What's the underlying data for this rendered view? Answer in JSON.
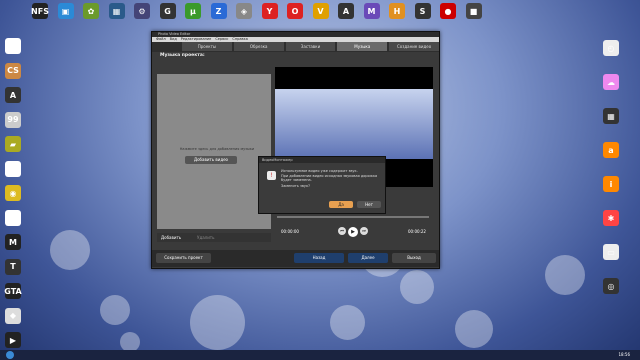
{
  "desktop": {
    "top_icons": [
      {
        "name": "need-for-speed-icon",
        "glyph": "NFS",
        "color": "#222"
      },
      {
        "name": "monitor-icon",
        "glyph": "▣",
        "color": "#2b8ad6"
      },
      {
        "name": "butterfly-icon",
        "glyph": "✿",
        "color": "#6b9a2b"
      },
      {
        "name": "video-app-icon",
        "glyph": "▦",
        "color": "#2a5a8a"
      },
      {
        "name": "gear-icon",
        "glyph": "⚙",
        "color": "#447"
      },
      {
        "name": "g-icon",
        "glyph": "G",
        "color": "#333"
      },
      {
        "name": "torrent-icon",
        "glyph": "µ",
        "color": "#3a9a2a"
      },
      {
        "name": "z-icon",
        "glyph": "Z",
        "color": "#2a6ad6"
      },
      {
        "name": "photo-app-icon",
        "glyph": "◈",
        "color": "#888"
      },
      {
        "name": "yandex-icon",
        "glyph": "Y",
        "color": "#d22"
      },
      {
        "name": "opera-icon",
        "glyph": "O",
        "color": "#d22"
      },
      {
        "name": "v-icon",
        "glyph": "V",
        "color": "#e0a000"
      },
      {
        "name": "a-icon",
        "glyph": "A",
        "color": "#333"
      },
      {
        "name": "m-icon",
        "glyph": "M",
        "color": "#6a4ab8"
      },
      {
        "name": "h-icon",
        "glyph": "H",
        "color": "#e09020"
      },
      {
        "name": "s-icon",
        "glyph": "S",
        "color": "#333"
      },
      {
        "name": "record-icon",
        "glyph": "●",
        "color": "#c00"
      },
      {
        "name": "box-icon",
        "glyph": "■",
        "color": "#444"
      }
    ],
    "left_icons": [
      {
        "name": "floppy-icon",
        "glyph": "▤",
        "color": "#fff"
      },
      {
        "name": "counter-strike-icon",
        "glyph": "CS",
        "color": "#c84"
      },
      {
        "name": "arma-icon",
        "glyph": "A",
        "color": "#333"
      },
      {
        "name": "fifa-icon",
        "glyph": "99",
        "color": "#ccc"
      },
      {
        "name": "car-icon",
        "glyph": "▰",
        "color": "#aa2"
      },
      {
        "name": "text-file-icon",
        "glyph": "▢",
        "color": "#fff"
      },
      {
        "name": "game-icon",
        "glyph": "◉",
        "color": "#db2"
      },
      {
        "name": "document-icon",
        "glyph": "▯",
        "color": "#fff"
      },
      {
        "name": "mafia-icon",
        "glyph": "M",
        "color": "#222"
      },
      {
        "name": "tanks-icon",
        "glyph": "T",
        "color": "#333"
      },
      {
        "name": "gta-icon",
        "glyph": "GTA",
        "color": "#222"
      },
      {
        "name": "cube-icon",
        "glyph": "◆",
        "color": "#ddd"
      },
      {
        "name": "play-icon",
        "glyph": "▶",
        "color": "#222"
      }
    ],
    "right_icons": [
      {
        "name": "clock-icon",
        "glyph": "◴",
        "color": "#eee"
      },
      {
        "name": "weather-icon",
        "glyph": "☁",
        "color": "#e8e"
      },
      {
        "name": "calculator-icon",
        "glyph": "▦",
        "color": "#333"
      },
      {
        "name": "avast-icon",
        "glyph": "a",
        "color": "#f80"
      },
      {
        "name": "info-icon",
        "glyph": "i",
        "color": "#f80"
      },
      {
        "name": "pinwheel-icon",
        "glyph": "✱",
        "color": "#f44"
      },
      {
        "name": "window-icon",
        "glyph": "▭",
        "color": "#eee"
      },
      {
        "name": "disk-icon",
        "glyph": "◎",
        "color": "#333"
      }
    ]
  },
  "window": {
    "title": "Photo Video Editor",
    "menu": [
      "Файл",
      "Вид",
      "Редактирование",
      "Сервис",
      "Справка"
    ],
    "tabs": [
      "Проекты",
      "Обрезка",
      "Заставки",
      "Музыка",
      "Создание видео"
    ],
    "active_tab": "Музыка",
    "panel_title": "Музыка проекта:",
    "hint_text": "Нажмите здесь для добавления музыки",
    "add_video_label": "Добавить видео",
    "add_label": "Добавить",
    "remove_label": "Удалить",
    "save_project_label": "Сохранить проект",
    "back_label": "Назад",
    "next_label": "Далее",
    "exit_label": "Выход",
    "time_start": "00:00:00",
    "time_end": "00:00:22"
  },
  "dialog": {
    "title": "ВидеоМонтажер",
    "text1": "Используемое видео уже содержит звук.",
    "text2": "При добавлении видео исходная звуковая дорожка будет заменена.",
    "text3": "Заменить звук?",
    "yes_label": "Да",
    "no_label": "Нет"
  },
  "taskbar": {
    "time": "18:56"
  }
}
